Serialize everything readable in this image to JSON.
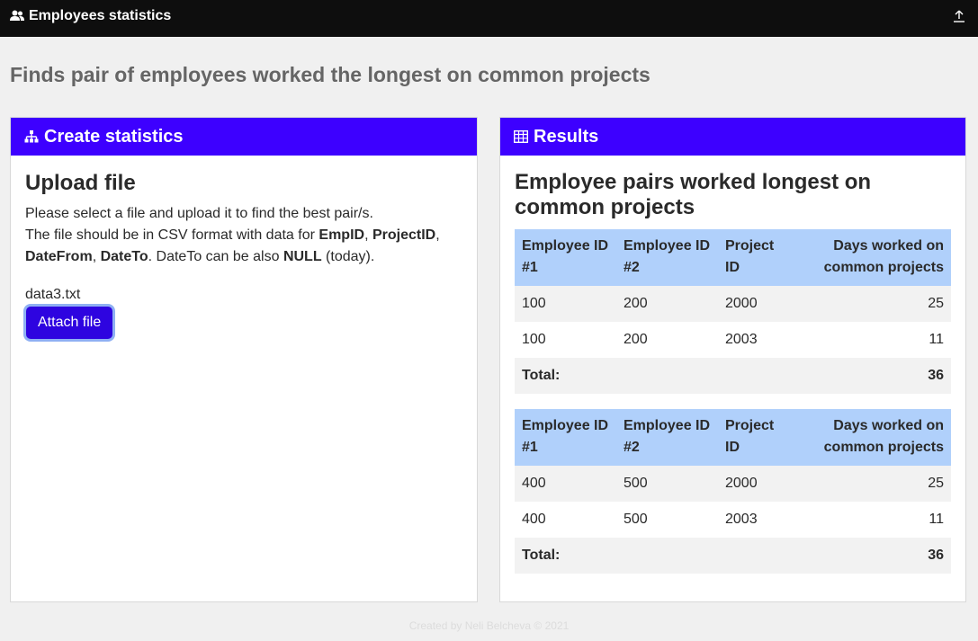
{
  "navbar": {
    "brand": "Employees statistics",
    "brand_icon": "users-icon",
    "upload_icon": "upload-icon"
  },
  "page_title": "Finds pair of employees worked the longest on common projects",
  "create_card": {
    "header": "Create statistics",
    "header_icon": "sitemap-icon",
    "heading": "Upload file",
    "line1": "Please select a file and upload it to find the best pair/s.",
    "line2_prefix": "The file should be in CSV format with data for ",
    "field1": "EmpID",
    "sep1": ", ",
    "field2": "ProjectID",
    "sep2": ",",
    "field3": "DateFrom",
    "sep3": ", ",
    "field4": "DateTo",
    "line2_mid": ". DateTo can be also ",
    "null_word": "NULL",
    "line2_suffix": " (today).",
    "filename": "data3.txt",
    "attach_label": "Attach file"
  },
  "results_card": {
    "header": "Results",
    "header_icon": "table-icon",
    "heading_line1": "Employee pairs worked longest on",
    "heading_line2": "common projects",
    "columns": [
      "Employee ID",
      "#1",
      "Employee ID",
      "#2",
      "Project",
      "ID",
      "Days worked on",
      "common projects"
    ],
    "tables": [
      {
        "rows": [
          [
            "100",
            "200",
            "2000",
            "25"
          ],
          [
            "100",
            "200",
            "2003",
            "11"
          ]
        ],
        "total_label": "Total:",
        "total_value": "36"
      },
      {
        "rows": [
          [
            "400",
            "500",
            "2000",
            "25"
          ],
          [
            "400",
            "500",
            "2003",
            "11"
          ]
        ],
        "total_label": "Total:",
        "total_value": "36"
      }
    ]
  },
  "footer": "Created by Neli Belcheva © 2021",
  "colors": {
    "navbar": "#0e0e0e",
    "card_header": "#3d00ff",
    "table_header": "#b0d0fb",
    "attach_button": "#2e04e0"
  }
}
